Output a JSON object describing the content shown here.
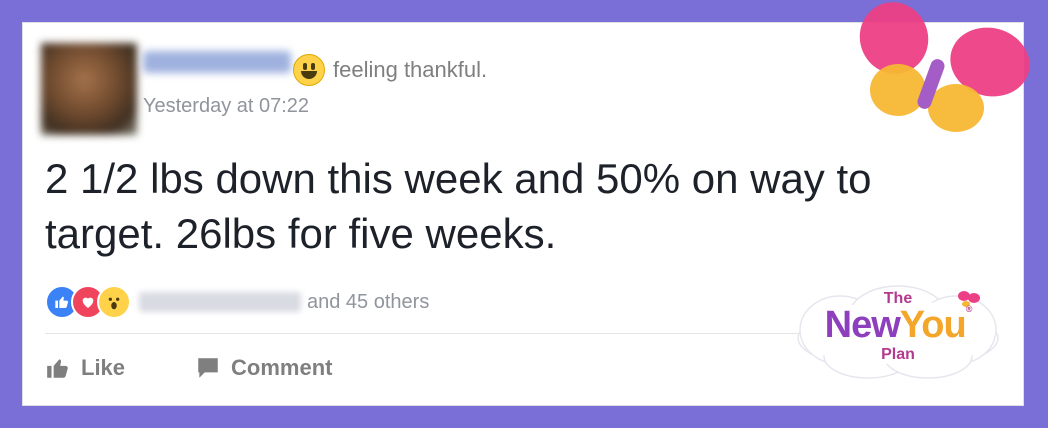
{
  "post": {
    "feeling": "feeling thankful.",
    "timestamp": "Yesterday at 07:22",
    "text": "2 1/2 lbs down this week and 50% on way to target. 26lbs for five weeks."
  },
  "reactions": {
    "icons": [
      "like-icon",
      "love-icon",
      "wow-icon"
    ],
    "others_text": "and 45 others"
  },
  "actions": {
    "like_label": "Like",
    "comment_label": "Comment"
  },
  "brand": {
    "line1": "The",
    "line2_new": "New",
    "line2_you": "You",
    "line3": "Plan"
  },
  "colors": {
    "frame": "#7a6fd6",
    "text": "#1d2129",
    "muted": "#90949c",
    "like_blue": "#3b82f6",
    "love_red": "#f0445d",
    "wow_yellow": "#ffd24a"
  }
}
